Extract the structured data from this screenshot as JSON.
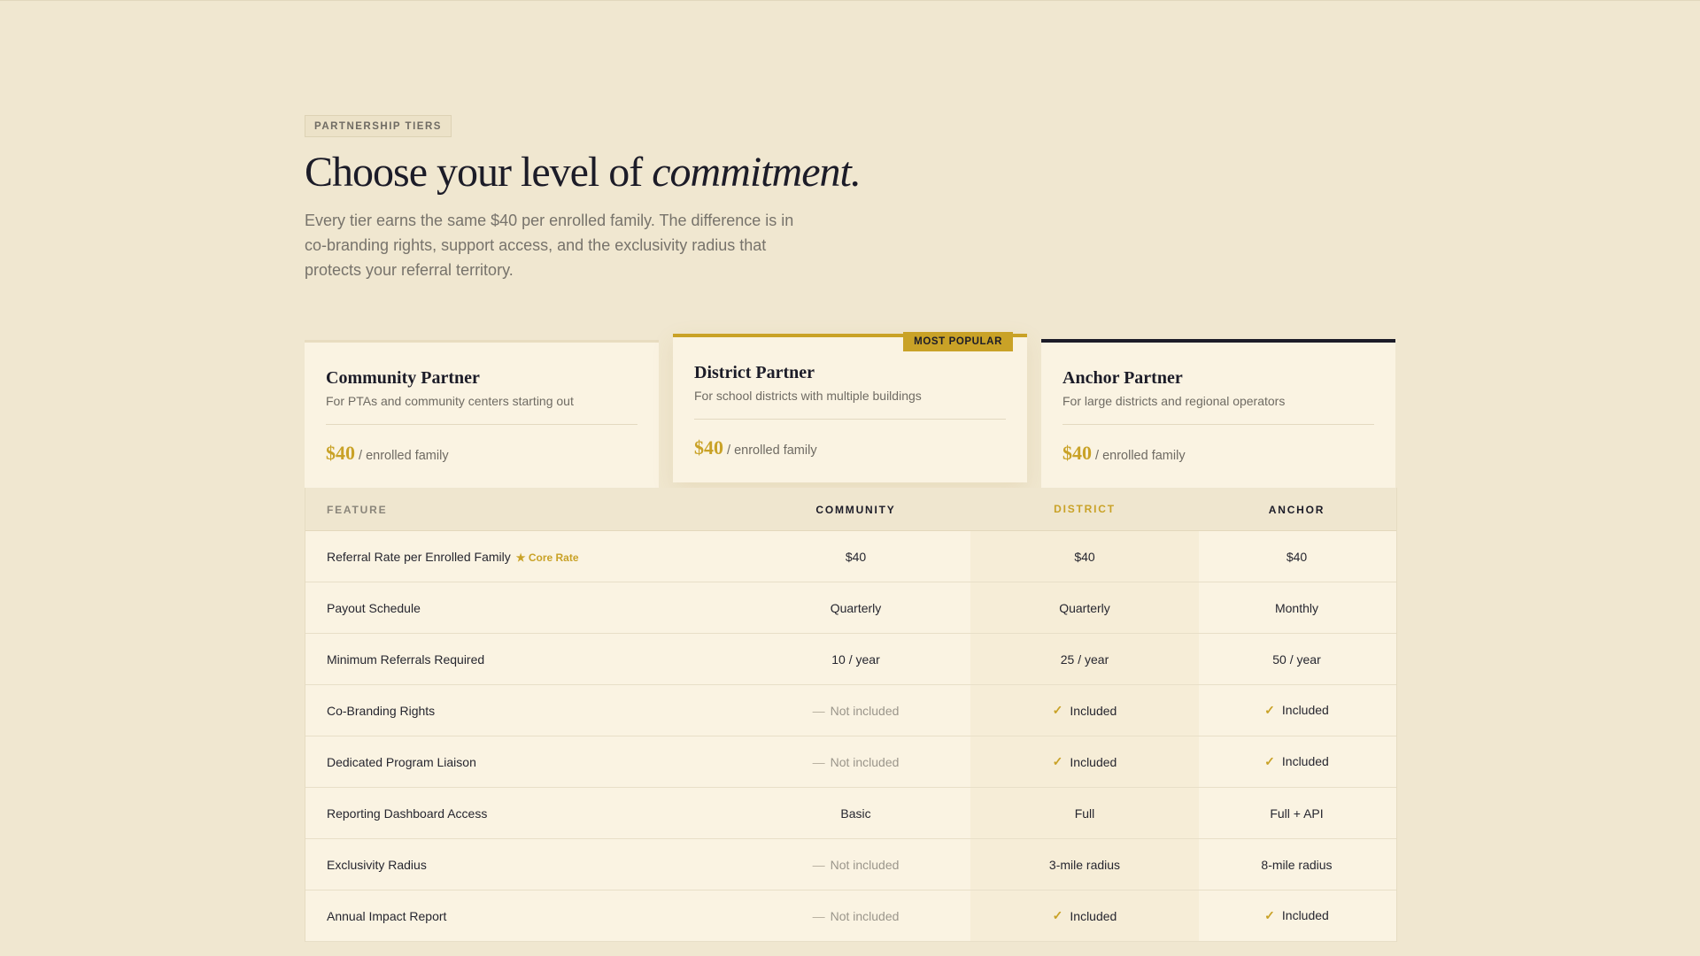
{
  "eyebrow": "PARTNERSHIP TIERS",
  "headline": {
    "lead": "Choose your level of ",
    "emphasis": "commitment."
  },
  "intro": "Every tier earns the same $40 per enrolled family. The difference is in co-branding rights, support access, and the exclusivity radius that protects your referral territory.",
  "colors": {
    "background": "#f0e7d0",
    "card": "#faf3e2",
    "accent_gold": "#c9a227",
    "ink": "#1c1c28"
  },
  "tiers": [
    {
      "name": "Community Partner",
      "desc": "For PTAs and community centers starting out",
      "amount": "$40",
      "unit": "/ enrolled family"
    },
    {
      "name": "District Partner",
      "desc": "For school districts with multiple buildings",
      "amount": "$40",
      "unit": "/ enrolled family",
      "badge": "MOST POPULAR"
    },
    {
      "name": "Anchor Partner",
      "desc": "For large districts and regional operators",
      "amount": "$40",
      "unit": "/ enrolled family"
    }
  ],
  "table": {
    "headers": {
      "feature": "FEATURE",
      "community": "COMMUNITY",
      "district": "DISTRICT",
      "anchor": "ANCHOR"
    },
    "rows": [
      {
        "feature": "Referral Rate per Enrolled Family",
        "tag": "★ Core Rate",
        "community": "$40",
        "district": "$40",
        "anchor": "$40"
      },
      {
        "feature": "Payout Schedule",
        "community": "Quarterly",
        "district": "Quarterly",
        "anchor": "Monthly"
      },
      {
        "feature": "Minimum Referrals Required",
        "community": "10 / year",
        "district": "25 / year",
        "anchor": "50 / year"
      },
      {
        "feature": "Co-Branding Rights",
        "community": "Not included",
        "district": "Included",
        "anchor": "Included"
      },
      {
        "feature": "Dedicated Program Liaison",
        "community": "Not included",
        "district": "Included",
        "anchor": "Included"
      },
      {
        "feature": "Reporting Dashboard Access",
        "community": "Basic",
        "district": "Full",
        "anchor": "Full + API"
      },
      {
        "feature": "Exclusivity Radius",
        "community": "Not included",
        "district": "3-mile radius",
        "anchor": "8-mile radius"
      },
      {
        "feature": "Annual Impact Report",
        "community": "Not included",
        "district": "Included",
        "anchor": "Included"
      }
    ],
    "symbols": {
      "dash": "—",
      "check": "✓"
    }
  }
}
